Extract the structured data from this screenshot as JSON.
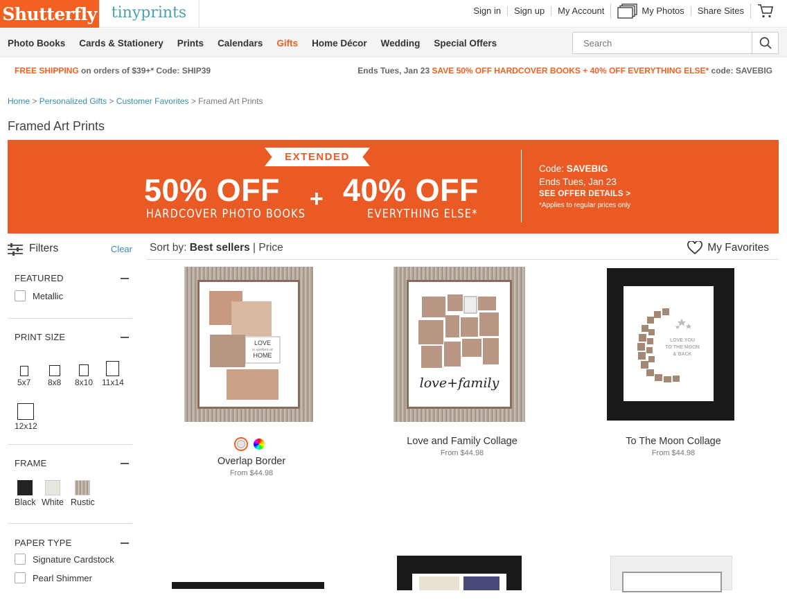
{
  "brand": {
    "shutterfly": "Shutterfly",
    "tinyprints": "tinyprints"
  },
  "toplinks": {
    "sign_in": "Sign in",
    "sign_up": "Sign up",
    "my_account": "My Account",
    "my_photos": "My Photos",
    "share_sites": "Share Sites"
  },
  "nav": {
    "items": [
      "Photo Books",
      "Cards & Stationery",
      "Prints",
      "Calendars",
      "Gifts",
      "Home Décor",
      "Wedding",
      "Special Offers"
    ]
  },
  "search": {
    "placeholder": "Search"
  },
  "promo": {
    "free_shipping": "FREE SHIPPING",
    "shipping_rest": " on orders of $39+* Code: SHIP39",
    "ends": "Ends Tues, Jan 23 ",
    "offer": "SAVE 50% OFF HARDCOVER BOOKS + 40% OFF EVERYTHING ELSE*",
    "code": " code: SAVEBIG"
  },
  "breadcrumb": {
    "home": "Home",
    "gifts": "Personalized Gifts",
    "favorites": "Customer Favorites",
    "current": "Framed Art Prints",
    "sep": " > "
  },
  "page_title": "Framed Art Prints",
  "banner": {
    "tag": "EXTENDED",
    "offer1": "50% OFF",
    "offer1_sub": "HARDCOVER PHOTO BOOKS",
    "plus": "+",
    "offer2": "40% OFF",
    "offer2_sub": "EVERYTHING ELSE*",
    "code_label": "Code: ",
    "code": "SAVEBIG",
    "ends": "Ends Tues, Jan 23",
    "details": "SEE OFFER DETAILS >",
    "note": "*Applies to regular prices only"
  },
  "filters": {
    "label": "Filters",
    "clear": "Clear",
    "featured": {
      "title": "FEATURED",
      "options": [
        "Metallic"
      ]
    },
    "print_size": {
      "title": "PRINT SIZE",
      "options": [
        "5x7",
        "8x8",
        "8x10",
        "11x14",
        "12x12"
      ]
    },
    "frame": {
      "title": "FRAME",
      "options": [
        "Black",
        "White",
        "Rustic"
      ]
    },
    "paper": {
      "title": "PAPER TYPE",
      "options": [
        "Signature Cardstock",
        "Pearl Shimmer"
      ]
    }
  },
  "sort": {
    "label": "Sort by: ",
    "best": "Best sellers",
    "sep": " | ",
    "price": "Price"
  },
  "favorites": "My Favorites",
  "products": [
    {
      "name": "Overlap Border",
      "price": "From $44.98",
      "frame": "rustic"
    },
    {
      "name": "Love and Family Collage",
      "price": "From $44.98",
      "frame": "rustic"
    },
    {
      "name": "To The Moon Collage",
      "price": "From $44.98",
      "frame": "black"
    }
  ],
  "art": {
    "love_home": [
      "LOVE",
      "is spoken at",
      "HOME"
    ],
    "love_family": "love+family",
    "moon": [
      "LOVE YOU",
      "TO THE MOON",
      "& BACK"
    ]
  },
  "colors": {
    "brand_orange": "#f26122",
    "banner": "#ea5a24",
    "link": "#3a8ea3"
  }
}
